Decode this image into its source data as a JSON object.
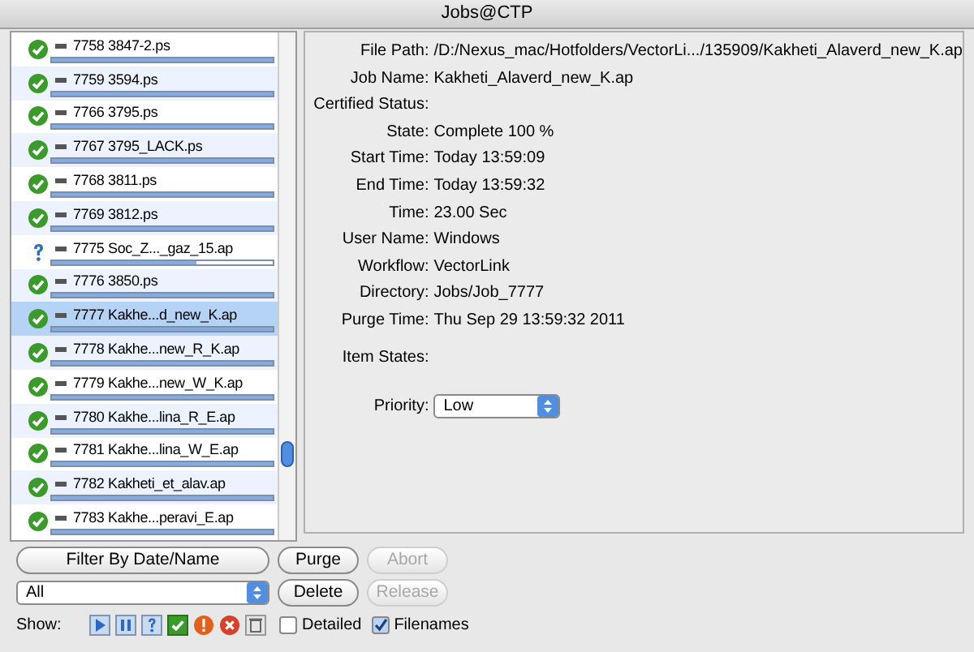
{
  "window": {
    "title": "Jobs@CTP"
  },
  "jobs": [
    {
      "name": "7758 3847-2.ps",
      "kind": "complete",
      "level": 1,
      "selected": false
    },
    {
      "name": "7759 3594.ps",
      "kind": "complete",
      "level": 1,
      "selected": false
    },
    {
      "name": "7766 3795.ps",
      "kind": "complete",
      "level": 1,
      "selected": false
    },
    {
      "name": "7767 3795_LACK.ps",
      "kind": "complete",
      "level": 1,
      "selected": false
    },
    {
      "name": "7768 3811.ps",
      "kind": "complete",
      "level": 1,
      "selected": false
    },
    {
      "name": "7769 3812.ps",
      "kind": "complete",
      "level": 1,
      "selected": false
    },
    {
      "name": "7775 Soc_Z..._gaz_15.ap",
      "kind": "unknown",
      "level": 0.65,
      "selected": false
    },
    {
      "name": "7776 3850.ps",
      "kind": "complete",
      "level": 1,
      "selected": false
    },
    {
      "name": "7777 Kakhe...d_new_K.ap",
      "kind": "complete",
      "level": 1,
      "selected": true
    },
    {
      "name": "7778 Kakhe...new_R_K.ap",
      "kind": "complete",
      "level": 1,
      "selected": false
    },
    {
      "name": "7779 Kakhe...new_W_K.ap",
      "kind": "complete",
      "level": 1,
      "selected": false
    },
    {
      "name": "7780 Kakhe...lina_R_E.ap",
      "kind": "complete",
      "level": 1,
      "selected": false
    },
    {
      "name": "7781 Kakhe...lina_W_E.ap",
      "kind": "complete",
      "level": 1,
      "selected": false
    },
    {
      "name": "7782 Kakheti_et_alav.ap",
      "kind": "complete",
      "level": 1,
      "selected": false
    },
    {
      "name": "7783 Kakhe...peravi_E.ap",
      "kind": "complete",
      "level": 1,
      "selected": false
    }
  ],
  "details": [
    {
      "label": "File Path:",
      "value": "/D:/Nexus_mac/Hotfolders/VectorLi.../135909/Kakheti_Alaverd_new_K.ap"
    },
    {
      "label": "Job Name:",
      "value": "Kakheti_Alaverd_new_K.ap"
    },
    {
      "label": "Certified Status:"
    },
    {
      "label": "State:",
      "value": "Complete 100 %"
    },
    {
      "label": "Start Time:",
      "value": "Today 13:59:09"
    },
    {
      "label": "End Time:",
      "value": "Today 13:59:32"
    },
    {
      "label": "Time:",
      "value": "23.00 Sec"
    },
    {
      "label": "User Name:",
      "value": "Windows"
    },
    {
      "label": "Workflow:",
      "value": "VectorLink"
    },
    {
      "label": "Directory:",
      "value": "Jobs/Job_7777"
    },
    {
      "label": "Purge Time:",
      "value": "Thu Sep 29 13:59:32 2011"
    }
  ],
  "item_states_label": "Item States:",
  "priority": {
    "label": "Priority:",
    "value": "Low"
  },
  "filter_button": {
    "label": "Filter By Date/Name"
  },
  "filter_select": {
    "value": "All"
  },
  "buttons": [
    {
      "label": "Purge",
      "disabled": false
    },
    {
      "label": "Abort",
      "disabled": true
    },
    {
      "label": "Delete",
      "disabled": false
    },
    {
      "label": "Release",
      "disabled": true
    }
  ],
  "show_label": "Show:",
  "show_filters": [
    {
      "kind": "play"
    },
    {
      "kind": "pause"
    },
    {
      "kind": "unknown"
    },
    {
      "kind": "complete"
    },
    {
      "kind": "warning"
    },
    {
      "kind": "error"
    },
    {
      "kind": "trash"
    }
  ],
  "checkboxes": [
    {
      "label": "Detailed",
      "checked": false
    },
    {
      "label": "Filenames",
      "checked": true
    }
  ]
}
